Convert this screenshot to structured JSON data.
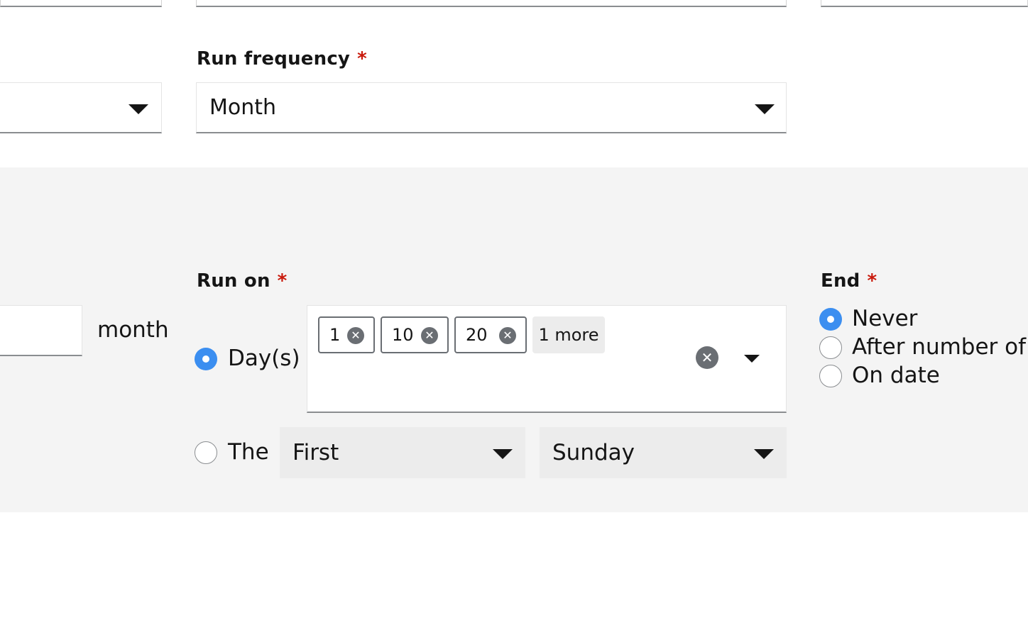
{
  "frequency": {
    "label": "Run frequency",
    "required_mark": "*",
    "value": "Month"
  },
  "interval": {
    "unit_text": "month"
  },
  "run_on": {
    "label": "Run on",
    "required_mark": "*",
    "days_option_label": "Day(s)",
    "days_selected": true,
    "chips": [
      "1",
      "10",
      "20"
    ],
    "more_label": "1 more",
    "the_option_label": "The",
    "the_selected": false,
    "ordinal_value": "First",
    "weekday_value": "Sunday"
  },
  "end": {
    "label": "End",
    "required_mark": "*",
    "options": [
      "Never",
      "After number of o",
      "On date"
    ],
    "selected_index": 0
  },
  "colors": {
    "accent": "#3b8ef0",
    "required": "#c9190b",
    "band_bg": "#f4f4f4"
  }
}
